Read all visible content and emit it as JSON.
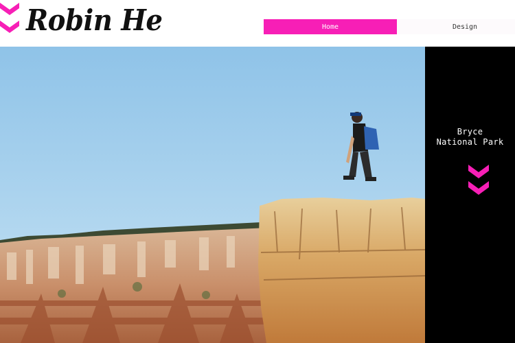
{
  "header": {
    "title": "Robin He",
    "logo_icon": "pink-double-chevron-icon"
  },
  "nav": {
    "items": [
      {
        "label": "Home",
        "active": true
      },
      {
        "label": "Design",
        "active": false
      }
    ]
  },
  "side_panel": {
    "caption_line1": "Bryce",
    "caption_line2": "National Park",
    "scroll_icon": "pink-double-chevron-down-icon"
  },
  "colors": {
    "accent": "#f71fb6",
    "panel": "#000000",
    "sky": "#a9d3ee"
  }
}
